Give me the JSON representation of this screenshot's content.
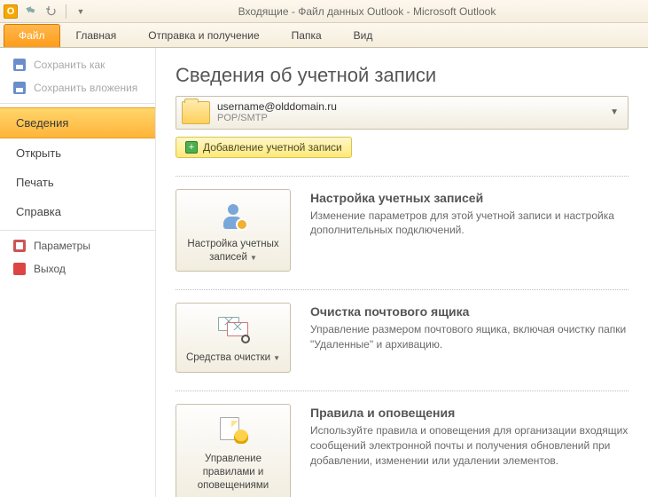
{
  "titlebar": {
    "text": "Входящие - Файл данных Outlook  -  Microsoft Outlook"
  },
  "ribbon": {
    "file": "Файл",
    "tabs": [
      "Главная",
      "Отправка и получение",
      "Папка",
      "Вид"
    ]
  },
  "left": {
    "save_as": "Сохранить как",
    "save_attachments": "Сохранить вложения",
    "nav": {
      "info": "Сведения",
      "open": "Открыть",
      "print": "Печать",
      "help": "Справка"
    },
    "options": "Параметры",
    "exit": "Выход"
  },
  "page": {
    "title": "Сведения об учетной записи",
    "account": {
      "email": "username@olddomain.ru",
      "protocol": "POP/SMTP"
    },
    "add_account": "Добавление учетной записи",
    "sections": [
      {
        "button": "Настройка учетных записей",
        "dropdown": true,
        "heading": "Настройка учетных записей",
        "desc": "Изменение параметров для этой учетной записи и настройка дополнительных подключений."
      },
      {
        "button": "Средства очистки",
        "dropdown": true,
        "heading": "Очистка почтового ящика",
        "desc": "Управление размером почтового ящика, включая очистку папки \"Удаленные\" и архивацию."
      },
      {
        "button": "Управление правилами и оповещениями",
        "dropdown": false,
        "heading": "Правила и оповещения",
        "desc": "Используйте правила и оповещения для организации входящих сообщений электронной почты и получения обновлений при добавлении, изменении или удалении элементов."
      }
    ]
  }
}
